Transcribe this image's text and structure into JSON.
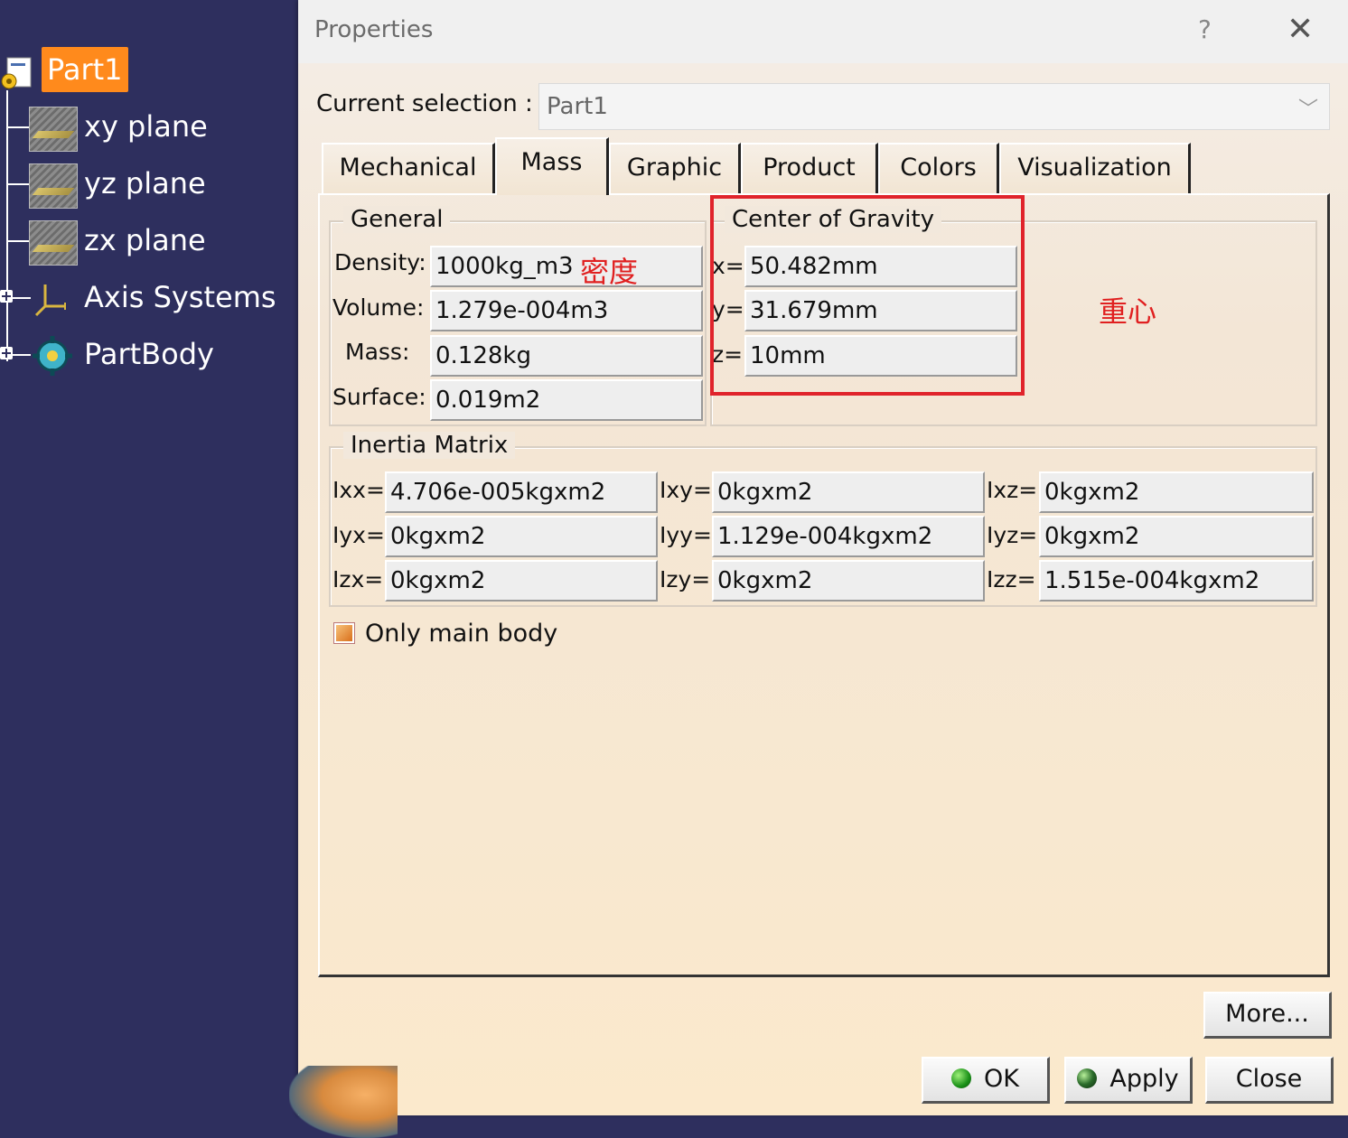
{
  "tree": {
    "root": "Part1",
    "items": [
      {
        "label": "xy plane",
        "icon": "plane-icon"
      },
      {
        "label": "yz plane",
        "icon": "plane-icon"
      },
      {
        "label": "zx plane",
        "icon": "plane-icon"
      },
      {
        "label": "Axis Systems",
        "icon": "axis-system-icon"
      },
      {
        "label": "PartBody",
        "icon": "part-body-icon"
      }
    ]
  },
  "dialog": {
    "title": "Properties",
    "help": "?",
    "close": "✕",
    "current_selection_label": "Current selection :",
    "current_selection_value": "Part1",
    "tabs": [
      "Mechanical",
      "Mass",
      "Graphic",
      "Product",
      "Colors",
      "Visualization"
    ],
    "active_tab": "Mass",
    "general": {
      "legend": "General",
      "density_label": "Density:",
      "density_value": "1000kg_m3",
      "volume_label": "Volume:",
      "volume_value": "1.279e-004m3",
      "mass_label": "Mass:",
      "mass_value": "0.128kg",
      "surface_label": "Surface:",
      "surface_value": "0.019m2"
    },
    "cog": {
      "legend": "Center of Gravity",
      "x_label": "x=",
      "x_value": "50.482mm",
      "y_label": "y=",
      "y_value": "31.679mm",
      "z_label": "z=",
      "z_value": "10mm"
    },
    "inertia": {
      "legend": "Inertia Matrix",
      "cells": [
        {
          "label": "Ixx=",
          "value": "4.706e-005kgxm2"
        },
        {
          "label": "Ixy=",
          "value": "0kgxm2"
        },
        {
          "label": "Ixz=",
          "value": "0kgxm2"
        },
        {
          "label": "Iyx=",
          "value": "0kgxm2"
        },
        {
          "label": "Iyy=",
          "value": "1.129e-004kgxm2"
        },
        {
          "label": "Iyz=",
          "value": "0kgxm2"
        },
        {
          "label": "Izx=",
          "value": "0kgxm2"
        },
        {
          "label": "Izy=",
          "value": "0kgxm2"
        },
        {
          "label": "Izz=",
          "value": "1.515e-004kgxm2"
        }
      ]
    },
    "only_main_body": "Only main body",
    "buttons": {
      "more": "More...",
      "ok": "OK",
      "apply": "Apply",
      "close": "Close"
    }
  },
  "annotations": {
    "density": "密度",
    "center_of_gravity": "重心",
    "color": "#e0232b"
  },
  "colors": {
    "tree_background": "#2e2f5e",
    "root_highlight": "#ff8a1c"
  }
}
